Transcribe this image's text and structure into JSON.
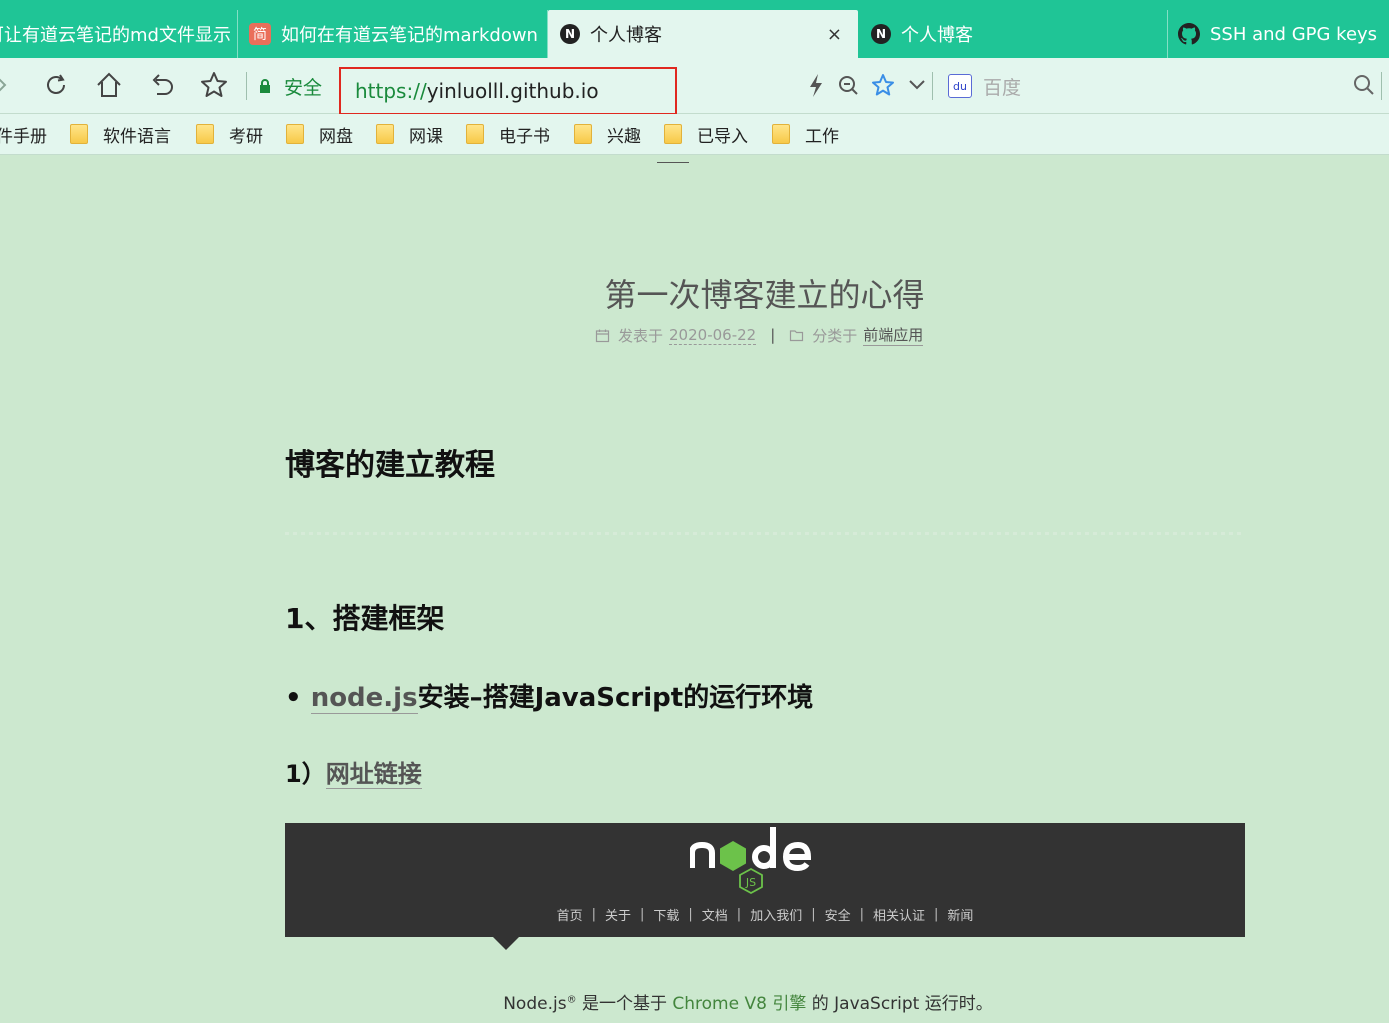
{
  "browser": {
    "tabs": [
      {
        "label": "可让有道云笔记的md文件显示",
        "icon": "note-icon"
      },
      {
        "label": "如何在有道云笔记的markdown",
        "icon": "jianshu-icon",
        "icon_text": "简"
      },
      {
        "label": "个人博客",
        "icon": "next-n-icon",
        "icon_text": "N",
        "active": true,
        "close": "×"
      },
      {
        "label": "个人博客",
        "icon": "next-n-icon",
        "icon_text": "N"
      },
      {
        "label": "SSH and GPG keys",
        "icon": "github-icon"
      }
    ],
    "toolbar": {
      "secure_label": "安全",
      "url_scheme": "https://",
      "url_host": "yinluolll.github.io",
      "search_engine_icon_text": "du",
      "search_engine_placeholder": "百度"
    },
    "bookmarks": [
      {
        "label": "件手册",
        "folder": false
      },
      {
        "label": "软件语言",
        "folder": true
      },
      {
        "label": "考研",
        "folder": true
      },
      {
        "label": "网盘",
        "folder": true
      },
      {
        "label": "网课",
        "folder": true
      },
      {
        "label": "电子书",
        "folder": true
      },
      {
        "label": "兴趣",
        "folder": true
      },
      {
        "label": "已导入",
        "folder": true
      },
      {
        "label": "工作",
        "folder": true
      }
    ],
    "colors": {
      "tab_strip": "#1fc596",
      "toolbar": "#e3f6ee",
      "page_background": "#cce8cf",
      "url_highlight": "#e0281f",
      "secure_green": "#1a8a3c"
    }
  },
  "post": {
    "title": "第一次博客建立的心得",
    "meta": {
      "posted_prefix": "发表于",
      "date": "2020-06-22",
      "separator": "|",
      "category_prefix": "分类于",
      "category": "前端应用"
    },
    "h1": "博客的建立教程",
    "h2": "1、搭建框架",
    "bullet": {
      "marker": "•",
      "link": "node.js",
      "text": "安装–搭建JavaScript的运行环境"
    },
    "sub": {
      "prefix": "1）",
      "link": "网址链接"
    }
  },
  "node_site": {
    "nav": [
      "首页",
      "关于",
      "下载",
      "文档",
      "加入我们",
      "安全",
      "相关认证",
      "新闻"
    ],
    "nav_separator": "|",
    "desc": {
      "part1": "Node.js",
      "reg": "®",
      "part2": " 是一个基于 ",
      "link": "Chrome V8 引擎",
      "part3": " 的 JavaScript 运行时。"
    }
  }
}
